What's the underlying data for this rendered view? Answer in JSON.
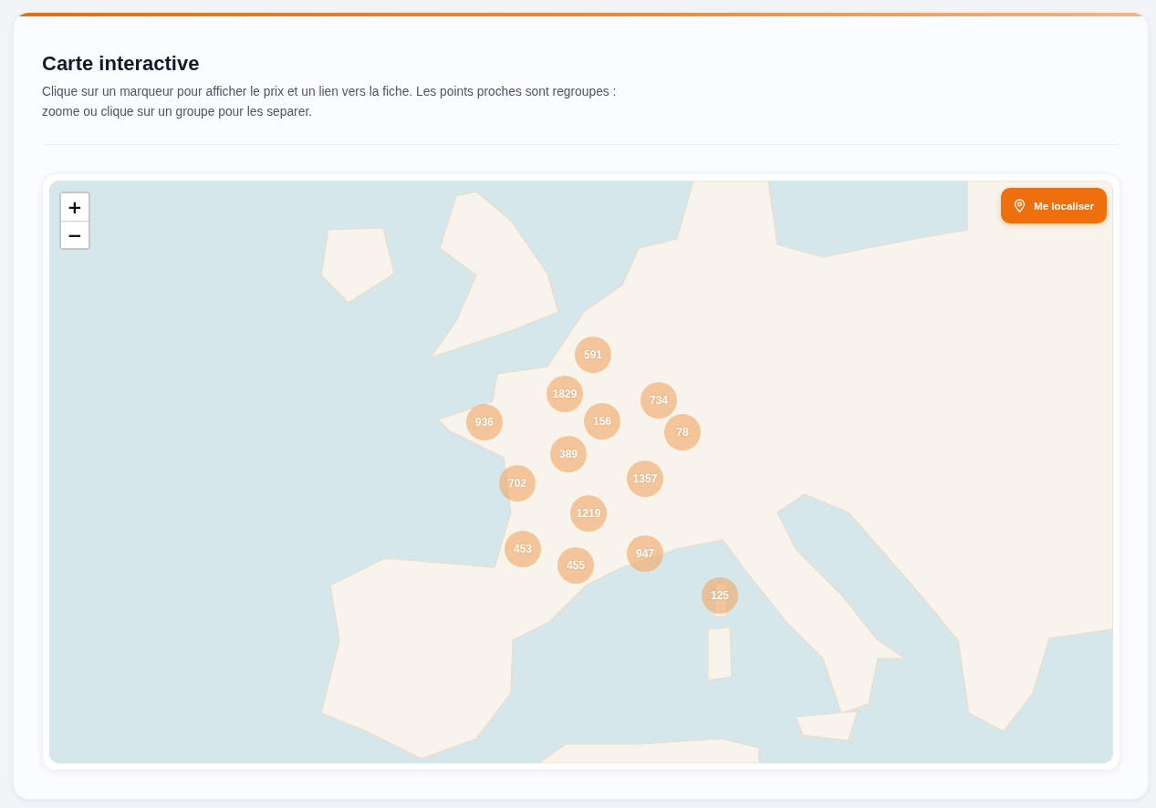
{
  "header": {
    "title": "Carte interactive",
    "description": "Clique sur un marqueur pour afficher le prix et un lien vers la fiche. Les points proches sont regroupes : zoome ou clique sur un groupe pour les separer."
  },
  "map": {
    "zoom_controls": [
      {
        "label": "+"
      },
      {
        "label": "−"
      }
    ],
    "locate_button": {
      "label": "Me localiser"
    },
    "clusters": [
      {
        "count": "591"
      },
      {
        "count": "1829"
      },
      {
        "count": "734"
      },
      {
        "count": "936"
      },
      {
        "count": "156"
      },
      {
        "count": "78"
      },
      {
        "count": "389"
      },
      {
        "count": "1357"
      },
      {
        "count": "702"
      },
      {
        "count": "1219"
      },
      {
        "count": "453"
      },
      {
        "count": "947"
      },
      {
        "count": "455"
      },
      {
        "count": "125"
      }
    ]
  }
}
